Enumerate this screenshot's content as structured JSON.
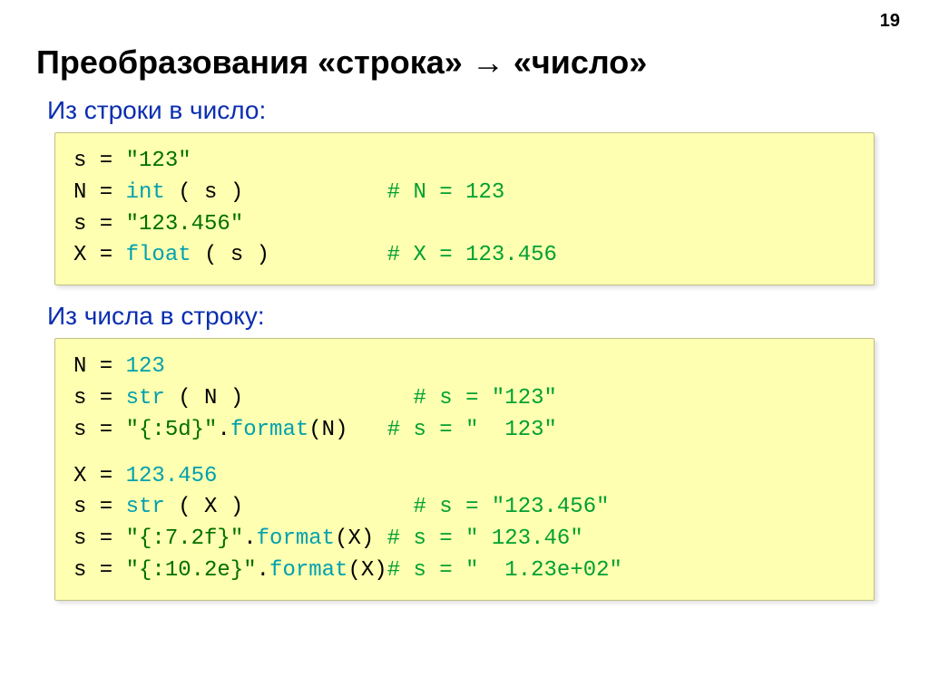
{
  "page_number": "19",
  "title": "Преобразования «строка» → «число»",
  "sub1": "Из строки в число:",
  "sub2": "Из числа в строку:",
  "code1": {
    "l1a": "s = ",
    "l1b": "\"123\"",
    "l2a": "N = ",
    "l2b": "int",
    "l2c": " ( s )",
    "l2d": "           # N = 123",
    "l3a": "s = ",
    "l3b": "\"123.456\"",
    "l4a": "X = ",
    "l4b": "float",
    "l4c": " ( s )",
    "l4d": "         # X = 123.456"
  },
  "code2": {
    "l1a": "N = ",
    "l1b": "123",
    "l2a": "s = ",
    "l2b": "str",
    "l2c": " ( N )",
    "l2d": "             # s = \"123\"",
    "l3a": "s = ",
    "l3b": "\"{:5d}\"",
    "l3c": ".",
    "l3d": "format",
    "l3e": "(N)",
    "l3f": "   # s = \"  123\"",
    "l4a": "X = ",
    "l4b": "123.456",
    "l5a": "s = ",
    "l5b": "str",
    "l5c": " ( X )",
    "l5d": "             # s = \"123.456\"",
    "l6a": "s = ",
    "l6b": "\"{:7.2f}\"",
    "l6c": ".",
    "l6d": "format",
    "l6e": "(X)",
    "l6f": " # s = \" 123.46\"",
    "l7a": "s = ",
    "l7b": "\"{:10.2e}\"",
    "l7c": ".",
    "l7d": "format",
    "l7e": "(X)",
    "l7f": "# s = \"  1.23e+02\""
  }
}
